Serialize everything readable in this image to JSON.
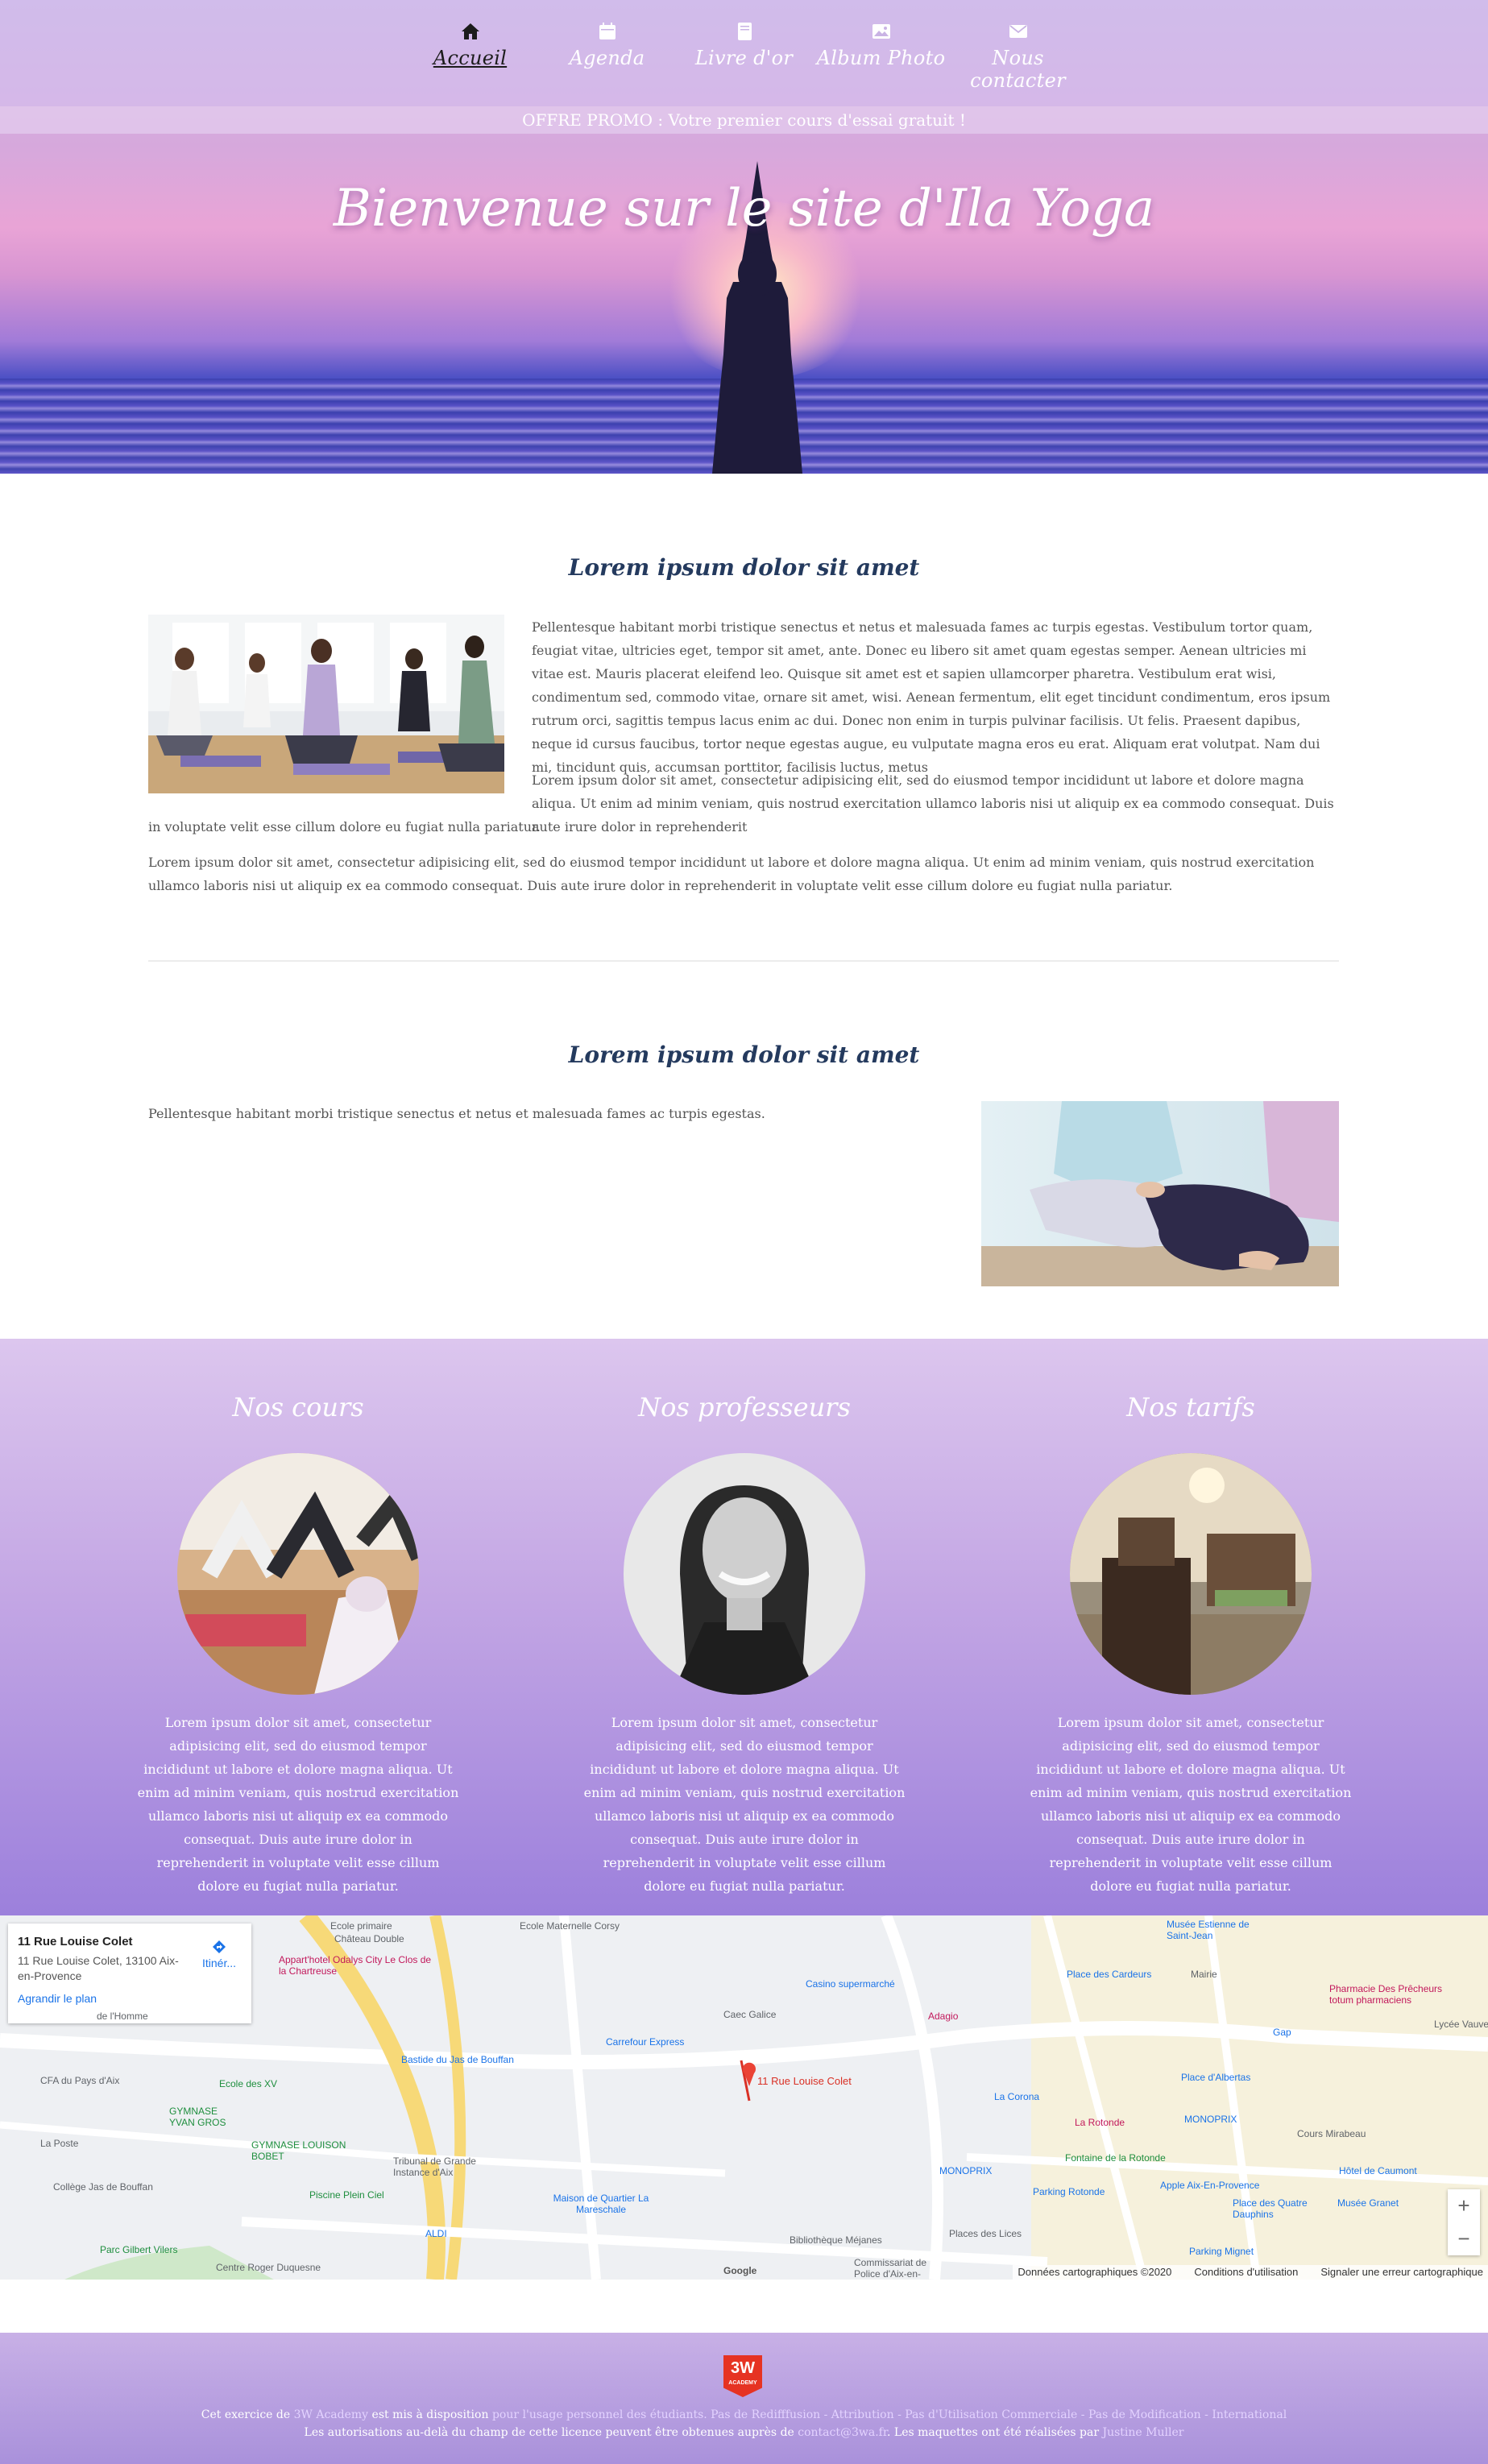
{
  "nav": {
    "items": [
      {
        "label": "Accueil",
        "icon": "home-icon",
        "active": true
      },
      {
        "label": "Agenda",
        "icon": "calendar-icon",
        "active": false
      },
      {
        "label": "Livre d'or",
        "icon": "book-icon",
        "active": false
      },
      {
        "label": "Album Photo",
        "icon": "image-icon",
        "active": false
      },
      {
        "label": "Nous contacter",
        "icon": "envelope-icon",
        "active": false
      }
    ]
  },
  "promo": "OFFRE PROMO : Votre premier cours d'essai gratuit !",
  "hero": {
    "title": "Bienvenue sur le site d'Ila Yoga"
  },
  "section1": {
    "title": "Lorem ipsum dolor sit amet",
    "p1": "Pellentesque habitant morbi tristique senectus et netus et malesuada fames ac turpis egestas. Vestibulum tortor quam, feugiat vitae, ultricies eget, tempor sit amet, ante. Donec eu libero sit amet quam egestas semper. Aenean ultricies mi vitae est. Mauris placerat eleifend leo. Quisque sit amet est et sapien ullamcorper pharetra. Vestibulum erat wisi, condimentum sed, commodo vitae, ornare sit amet, wisi. Aenean fermentum, elit eget tincidunt condimentum, eros ipsum rutrum orci, sagittis tempus lacus enim ac dui. Donec non enim in turpis pulvinar facilisis. Ut felis. Praesent dapibus, neque id cursus faucibus, tortor neque egestas augue, eu vulputate magna eros eu erat. Aliquam erat volutpat. Nam dui mi, tincidunt quis, accumsan porttitor, facilisis luctus, metus",
    "p2a": "Lorem ipsum dolor sit amet, consectetur adipisicing elit, sed do eiusmod tempor incididunt ut labore et dolore magna aliqua. Ut enim ad minim veniam, quis nostrud exercitation ullamco laboris nisi ut aliquip ex ea commodo consequat. Duis aute irure dolor in reprehenderit",
    "p2b": "in voluptate velit esse cillum dolore eu fugiat nulla pariatur.",
    "p3": "Lorem ipsum dolor sit amet, consectetur adipisicing elit, sed do eiusmod tempor incididunt ut labore et dolore magna aliqua. Ut enim ad minim veniam, quis nostrud exercitation ullamco laboris nisi ut aliquip ex ea commodo consequat. Duis aute irure dolor in reprehenderit in voluptate velit esse cillum dolore eu fugiat nulla pariatur."
  },
  "section2": {
    "title": "Lorem ipsum dolor sit amet",
    "p1": "Pellentesque habitant morbi tristique senectus et netus et malesuada fames ac turpis egestas."
  },
  "features": [
    {
      "title": "Nos cours",
      "text": "Lorem ipsum dolor sit amet, consectetur adipisicing elit, sed do eiusmod tempor incididunt ut labore et dolore magna aliqua. Ut enim ad minim veniam, quis nostrud exercitation ullamco laboris nisi ut aliquip ex ea commodo consequat. Duis aute irure dolor in reprehenderit in voluptate velit esse cillum dolore eu fugiat nulla pariatur."
    },
    {
      "title": "Nos professeurs",
      "text": "Lorem ipsum dolor sit amet, consectetur adipisicing elit, sed do eiusmod tempor incididunt ut labore et dolore magna aliqua. Ut enim ad minim veniam, quis nostrud exercitation ullamco laboris nisi ut aliquip ex ea commodo consequat. Duis aute irure dolor in reprehenderit in voluptate velit esse cillum dolore eu fugiat nulla pariatur."
    },
    {
      "title": "Nos tarifs",
      "text": "Lorem ipsum dolor sit amet, consectetur adipisicing elit, sed do eiusmod tempor incididunt ut labore et dolore magna aliqua. Ut enim ad minim veniam, quis nostrud exercitation ullamco laboris nisi ut aliquip ex ea commodo consequat. Duis aute irure dolor in reprehenderit in voluptate velit esse cillum dolore eu fugiat nulla pariatur."
    }
  ],
  "map": {
    "card_title": "11 Rue Louise Colet",
    "card_address": "11 Rue Louise Colet, 13100 Aix-en-Provence",
    "directions_label": "Itinér...",
    "enlarge_label": "Agrandir le plan",
    "marker_label": "11 Rue Louise Colet",
    "labels": {
      "ecole_maternelle": "Ecole Maternelle Corsy",
      "appart_hotel": "Appart'hotel Odalys City Le Clos de la Chartreuse",
      "casino": "Casino supermarché",
      "place_cardeurs": "Place des Cardeurs",
      "mairie": "Mairie",
      "caec": "Caec Galice",
      "adagio": "Adagio",
      "carrefour": "Carrefour Express",
      "bastide": "Bastide du Jas de Bouffan",
      "cfa": "CFA du Pays d'Aix",
      "ecole_xv": "Ecole des XV",
      "gymnase_yvan": "GYMNASE YVAN GROS",
      "gymnase_louison": "GYMNASE LOUISON BOBET",
      "tribunal": "Tribunal de Grande Instance d'Aix",
      "la_poste": "La Poste",
      "college": "Collège Jas de Bouffan",
      "piscine": "Piscine Plein Ciel",
      "maison_quartier": "Maison de Quartier La Mareschale",
      "aldi": "ALDI",
      "parc": "Parc Gilbert Vilers",
      "centre_roger": "Centre Roger Duquesne",
      "la_corona": "La Corona",
      "monoprix1": "MONOPRIX",
      "monoprix2": "MONOPRIX",
      "la_rotonde": "La Rotonde",
      "fontaine": "Fontaine de la Rotonde",
      "place_albertas": "Place d'Albertas",
      "cours_mirabeau": "Cours Mirabeau",
      "hotel_caumont": "Hôtel de Caumont",
      "apple": "Apple Aix-En-Provence",
      "place_quatre": "Place des Quatre Dauphins",
      "musee_granet": "Musée Granet",
      "parking_rotonde": "Parking Rotonde",
      "parking_mignet": "Parking Mignet",
      "bibliotheque": "Bibliothèque Méjanes",
      "commissariat": "Commissariat de Police d'Aix-en-Provence",
      "places_loes": "Places des Lices",
      "pharmacie": "Pharmacie Des Prêcheurs totum pharmaciens",
      "lycee": "Lycée Vauver",
      "gap": "Gap",
      "musee_estienne": "Musée Estienne de Saint-Jean",
      "chateau": "Château Double",
      "ecole_primaire": "Ecole primaire",
      "de_lhomme": "de l'Homme"
    },
    "footer": [
      "Données cartographiques ©2020",
      "Conditions d'utilisation",
      "Signaler une erreur cartographique"
    ],
    "google": "Google"
  },
  "footer": {
    "logo_text": "3W",
    "logo_sub": "ACADEMY",
    "line1_a": "Cet exercice de ",
    "line1_link1": "3W Academy",
    "line1_b": " est mis à disposition ",
    "line1_link2": "pour l'usage personnel des étudiants. Pas de Redifffusion - Attribution - Pas d'Utilisation Commerciale - Pas de Modification - International",
    "line2_a": "Les autorisations au-delà du champ de cette licence peuvent être obtenues auprès de ",
    "line2_link1": "contact@3wa.fr",
    "line2_b": ". Les maquettes ont été réalisées par ",
    "line2_link2": "Justine Muller"
  }
}
